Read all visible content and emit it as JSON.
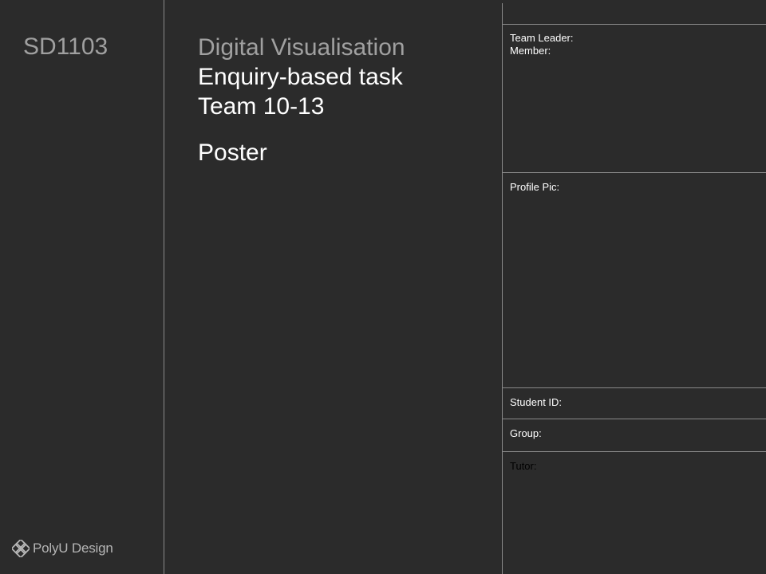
{
  "left_panel": {
    "course_code": "SD1103",
    "logo": {
      "icon": "polyu-knot-logo-icon",
      "text": "PolyU Design"
    }
  },
  "center_panel": {
    "subject": "Digital Visualisation",
    "task": "Enquiry-based task",
    "team": "Team 10-13",
    "deliverable": "Poster"
  },
  "right_panel": {
    "team_leader_label": "Team Leader:",
    "member_label": "Member:",
    "profile_pic_label": "Profile Pic:",
    "student_id_label": "Student ID:",
    "group_label": "Group:",
    "tutor_label": "Tutor:"
  },
  "colors": {
    "background": "#2b2b2b",
    "divider": "#8a8a8a",
    "muted_text": "#a0a0a0",
    "primary_text": "#ffffff",
    "tutor_text": "#000000"
  }
}
